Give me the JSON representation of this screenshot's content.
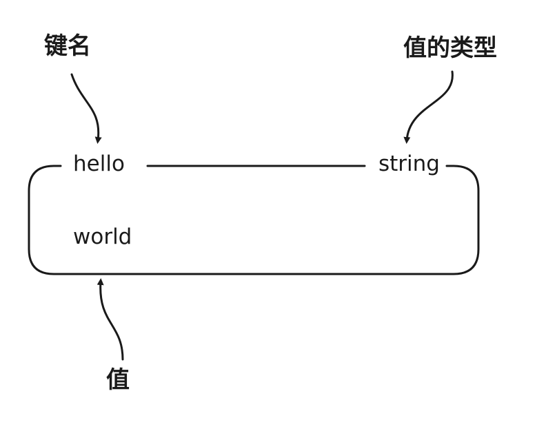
{
  "annotations": {
    "key_name": "键名",
    "value_type": "值的类型",
    "value": "值"
  },
  "record": {
    "key": "hello",
    "type": "string",
    "value": "world"
  },
  "colors": {
    "stroke": "#1a1a1a",
    "text": "#1a1a1a",
    "background": "#ffffff"
  }
}
